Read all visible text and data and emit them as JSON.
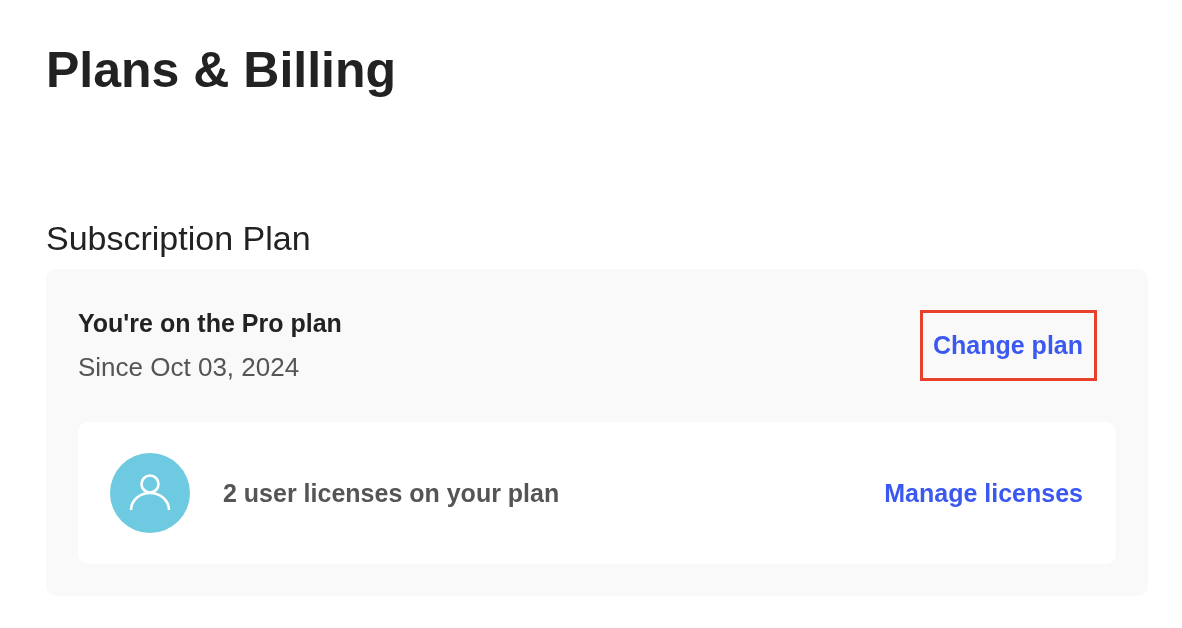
{
  "page": {
    "title": "Plans & Billing"
  },
  "subscription": {
    "heading": "Subscription Plan",
    "plan_title": "You're on the Pro plan",
    "since": "Since Oct 03, 2024",
    "change_plan": {
      "label": "Change plan",
      "highlighted": true
    },
    "licenses": {
      "text": "2 user licenses on your plan",
      "action": "Manage licenses"
    }
  }
}
